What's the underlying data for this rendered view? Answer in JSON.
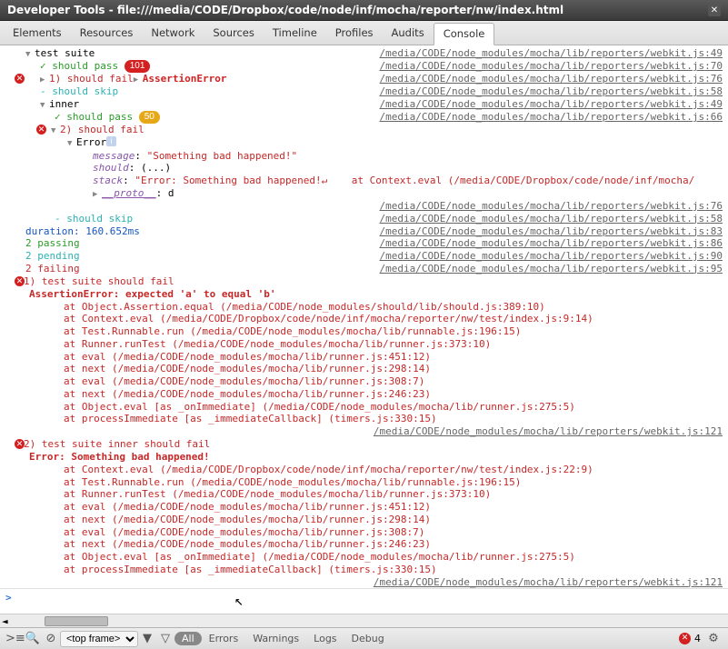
{
  "title": "Developer Tools - file:///media/CODE/Dropbox/code/node/inf/mocha/reporter/nw/index.html",
  "tabs": [
    "Elements",
    "Resources",
    "Network",
    "Sources",
    "Timeline",
    "Profiles",
    "Audits",
    "Console"
  ],
  "active_tab": "Console",
  "source_base": "/media/CODE/node_modules/mocha/lib/reporters/webkit.js",
  "rows": {
    "r0": {
      "text": "test suite",
      "src": ":49"
    },
    "r1": {
      "check": "✓",
      "text": " should pass ",
      "badge": "101",
      "src": ":70"
    },
    "r2": {
      "text": "1) should fail",
      "assert": "AssertionError",
      "src": ":76"
    },
    "r3": {
      "text": "- should skip",
      "src": ":58"
    },
    "r4": {
      "text": "inner",
      "src": ":49"
    },
    "r5": {
      "check": "✓",
      "text": " should pass ",
      "badge": "50",
      "src": ":66"
    },
    "r6": {
      "text": "2) should fail"
    },
    "r7": {
      "text": "Error"
    },
    "obj": {
      "message": "\"Something bad happened!\"",
      "should": "(...)",
      "stack": "\"Error: Something bad happened!↵    at Context.eval (/media/CODE/Dropbox/code/node/inf/mocha/",
      "proto": "d"
    },
    "r8": {
      "src": ":76"
    },
    "r9": {
      "text": "- should skip",
      "src": ":58"
    },
    "r10": {
      "text": "duration: 160.652ms",
      "src": ":83"
    },
    "r11": {
      "text": "2 passing",
      "src": ":86"
    },
    "r12": {
      "text": "2 pending",
      "src": ":90"
    },
    "r13": {
      "text": "2 failing",
      "src": ":95"
    }
  },
  "fail1": {
    "title": "1) test suite should fail",
    "err": "AssertionError: expected 'a' to equal 'b'",
    "stack": [
      "at Object.Assertion.equal (/media/CODE/node_modules/should/lib/should.js:389:10)",
      "at Context.eval (/media/CODE/Dropbox/code/node/inf/mocha/reporter/nw/test/index.js:9:14)",
      "at Test.Runnable.run (/media/CODE/node_modules/mocha/lib/runnable.js:196:15)",
      "at Runner.runTest (/media/CODE/node_modules/mocha/lib/runner.js:373:10)",
      "at eval (/media/CODE/node_modules/mocha/lib/runner.js:451:12)",
      "at next (/media/CODE/node_modules/mocha/lib/runner.js:298:14)",
      "at eval (/media/CODE/node_modules/mocha/lib/runner.js:308:7)",
      "at next (/media/CODE/node_modules/mocha/lib/runner.js:246:23)",
      "at Object.eval [as _onImmediate] (/media/CODE/node_modules/mocha/lib/runner.js:275:5)",
      "at processImmediate [as _immediateCallback] (timers.js:330:15)"
    ],
    "src": ":121"
  },
  "fail2": {
    "title": "2) test suite inner should fail",
    "err": "Error: Something bad happened!",
    "stack": [
      "at Context.eval (/media/CODE/Dropbox/code/node/inf/mocha/reporter/nw/test/index.js:22:9)",
      "at Test.Runnable.run (/media/CODE/node_modules/mocha/lib/runnable.js:196:15)",
      "at Runner.runTest (/media/CODE/node_modules/mocha/lib/runner.js:373:10)",
      "at eval (/media/CODE/node_modules/mocha/lib/runner.js:451:12)",
      "at next (/media/CODE/node_modules/mocha/lib/runner.js:298:14)",
      "at eval (/media/CODE/node_modules/mocha/lib/runner.js:308:7)",
      "at next (/media/CODE/node_modules/mocha/lib/runner.js:246:23)",
      "at Object.eval [as _onImmediate] (/media/CODE/node_modules/mocha/lib/runner.js:275:5)",
      "at processImmediate [as _immediateCallback] (timers.js:330:15)"
    ],
    "src": ":121"
  },
  "prompt": ">",
  "toolbar": {
    "frame": "<top frame>",
    "filters": [
      "All",
      "Errors",
      "Warnings",
      "Logs",
      "Debug"
    ],
    "err_count": "4"
  }
}
